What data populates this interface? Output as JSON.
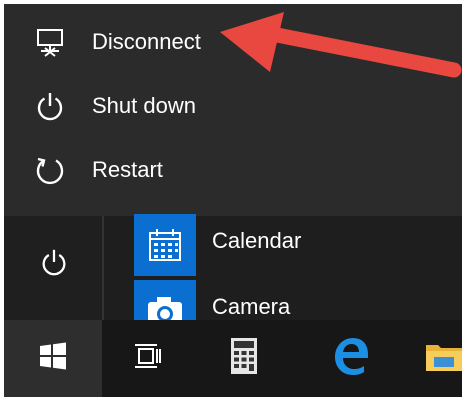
{
  "power_menu": {
    "items": [
      {
        "label": "Disconnect",
        "icon": "disconnect-icon"
      },
      {
        "label": "Shut down",
        "icon": "power-icon"
      },
      {
        "label": "Restart",
        "icon": "restart-icon"
      }
    ]
  },
  "start_menu": {
    "power_icon": "power-icon",
    "apps": [
      {
        "label": "Calendar",
        "icon": "calendar-icon"
      },
      {
        "label": "Camera",
        "icon": "camera-icon"
      }
    ]
  },
  "taskbar": {
    "buttons": [
      {
        "icon": "windows-logo-icon"
      },
      {
        "icon": "task-view-icon"
      },
      {
        "icon": "calculator-icon"
      },
      {
        "icon": "edge-browser-icon"
      },
      {
        "icon": "file-explorer-icon"
      }
    ]
  },
  "annotation": {
    "color": "#e8483f"
  },
  "colors": {
    "accent": "#0a6fd1",
    "menu_bg": "#2b2b2b",
    "taskbar_bg": "#171717"
  }
}
